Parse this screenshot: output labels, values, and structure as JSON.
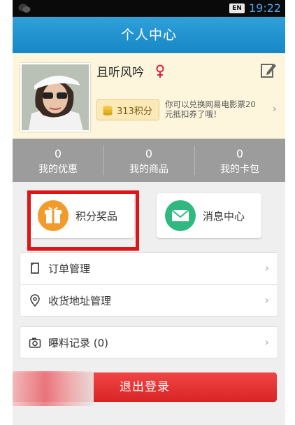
{
  "status_bar": {
    "lang_badge": "EN",
    "time": "19:22"
  },
  "title_bar": {
    "title": "个人中心"
  },
  "profile": {
    "username": "且听风吟",
    "points": "313积分",
    "promo_text": "你可以兑换网易电影票20元抵扣券了哦！"
  },
  "stats": [
    {
      "count": "0",
      "label": "我的优惠"
    },
    {
      "count": "0",
      "label": "我的商品"
    },
    {
      "count": "0",
      "label": "我的卡包"
    }
  ],
  "actions": {
    "rewards_label": "积分奖品",
    "messages_label": "消息中心"
  },
  "menu": {
    "orders": "订单管理",
    "address": "收货地址管理",
    "tips": "曝料记录 (0)"
  },
  "logout_label": "退出登录",
  "colors": {
    "title_bar": "#1f94d0",
    "logout": "#e23232",
    "highlight": "#e01414",
    "stats_bg": "#9c9c9c"
  }
}
